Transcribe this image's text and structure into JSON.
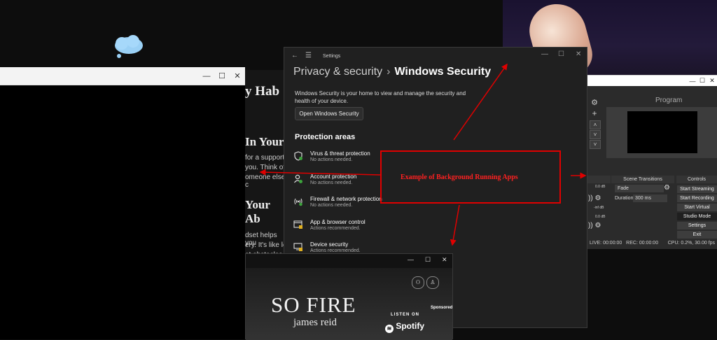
{
  "left_window": {
    "controls": [
      "—",
      "☐",
      "✕"
    ]
  },
  "article": {
    "heading1": "y Hab",
    "heading2": "In Your",
    "line1": "for a supporti",
    "line2": "you. Think of",
    "line3": "omeone else c",
    "heading3": "Your Ab",
    "line4": "dset helps you",
    "line5": "ery. It's like le",
    "line6": "at obstacles"
  },
  "settings": {
    "app_title": "Settings",
    "back_icon": "←",
    "menu_icon": "☰",
    "controls": [
      "—",
      "☐",
      "✕"
    ],
    "breadcrumb_parent": "Privacy & security",
    "breadcrumb_sep": "›",
    "breadcrumb_current": "Windows Security",
    "description": "Windows Security is your home to view and manage the security and health of your device.",
    "open_button": "Open Windows Security",
    "section_title": "Protection areas",
    "areas": [
      {
        "title": "Virus & threat protection",
        "status": "No actions needed.",
        "icon": "shield-virus-icon",
        "warn": false
      },
      {
        "title": "Account protection",
        "status": "No actions needed.",
        "icon": "account-icon",
        "warn": false
      },
      {
        "title": "Firewall & network protection",
        "status": "No actions needed.",
        "icon": "firewall-icon",
        "warn": false
      },
      {
        "title": "App & browser control",
        "status": "Actions recommended.",
        "icon": "app-browser-icon",
        "warn": true
      },
      {
        "title": "Device security",
        "status": "Actions recommended.",
        "icon": "device-security-icon",
        "warn": true
      }
    ]
  },
  "obs": {
    "controls": [
      "—",
      "☐",
      "✕"
    ],
    "program_label": "Program",
    "scene_transitions": "Scene Transitions",
    "controls_header": "Controls",
    "transition": "Fade",
    "duration_label": "Duration",
    "duration_value": "300 ms",
    "buttons": [
      "Start Streaming",
      "Start Recording",
      "Start Virtual Camera",
      "Studio Mode",
      "Settings",
      "Exit"
    ],
    "db1": "0.0 dB",
    "db2": "-inf dB",
    "db3": "0.0 dB",
    "status_live": "LIVE: 00:00:00",
    "status_rec": "REC: 00:00:00",
    "status_cpu": "CPU: 0.2%, 30.00 fps"
  },
  "spotify": {
    "controls": [
      "—",
      "☐",
      "✕"
    ],
    "ad_title": "SO FIRE",
    "ad_artist": "james reid",
    "sponsored": "Sponsored",
    "listen_on": "LISTEN ON",
    "brand": "Spotify"
  },
  "annotation": {
    "text": "Example of Background Running Apps",
    "color": "#e00000"
  }
}
